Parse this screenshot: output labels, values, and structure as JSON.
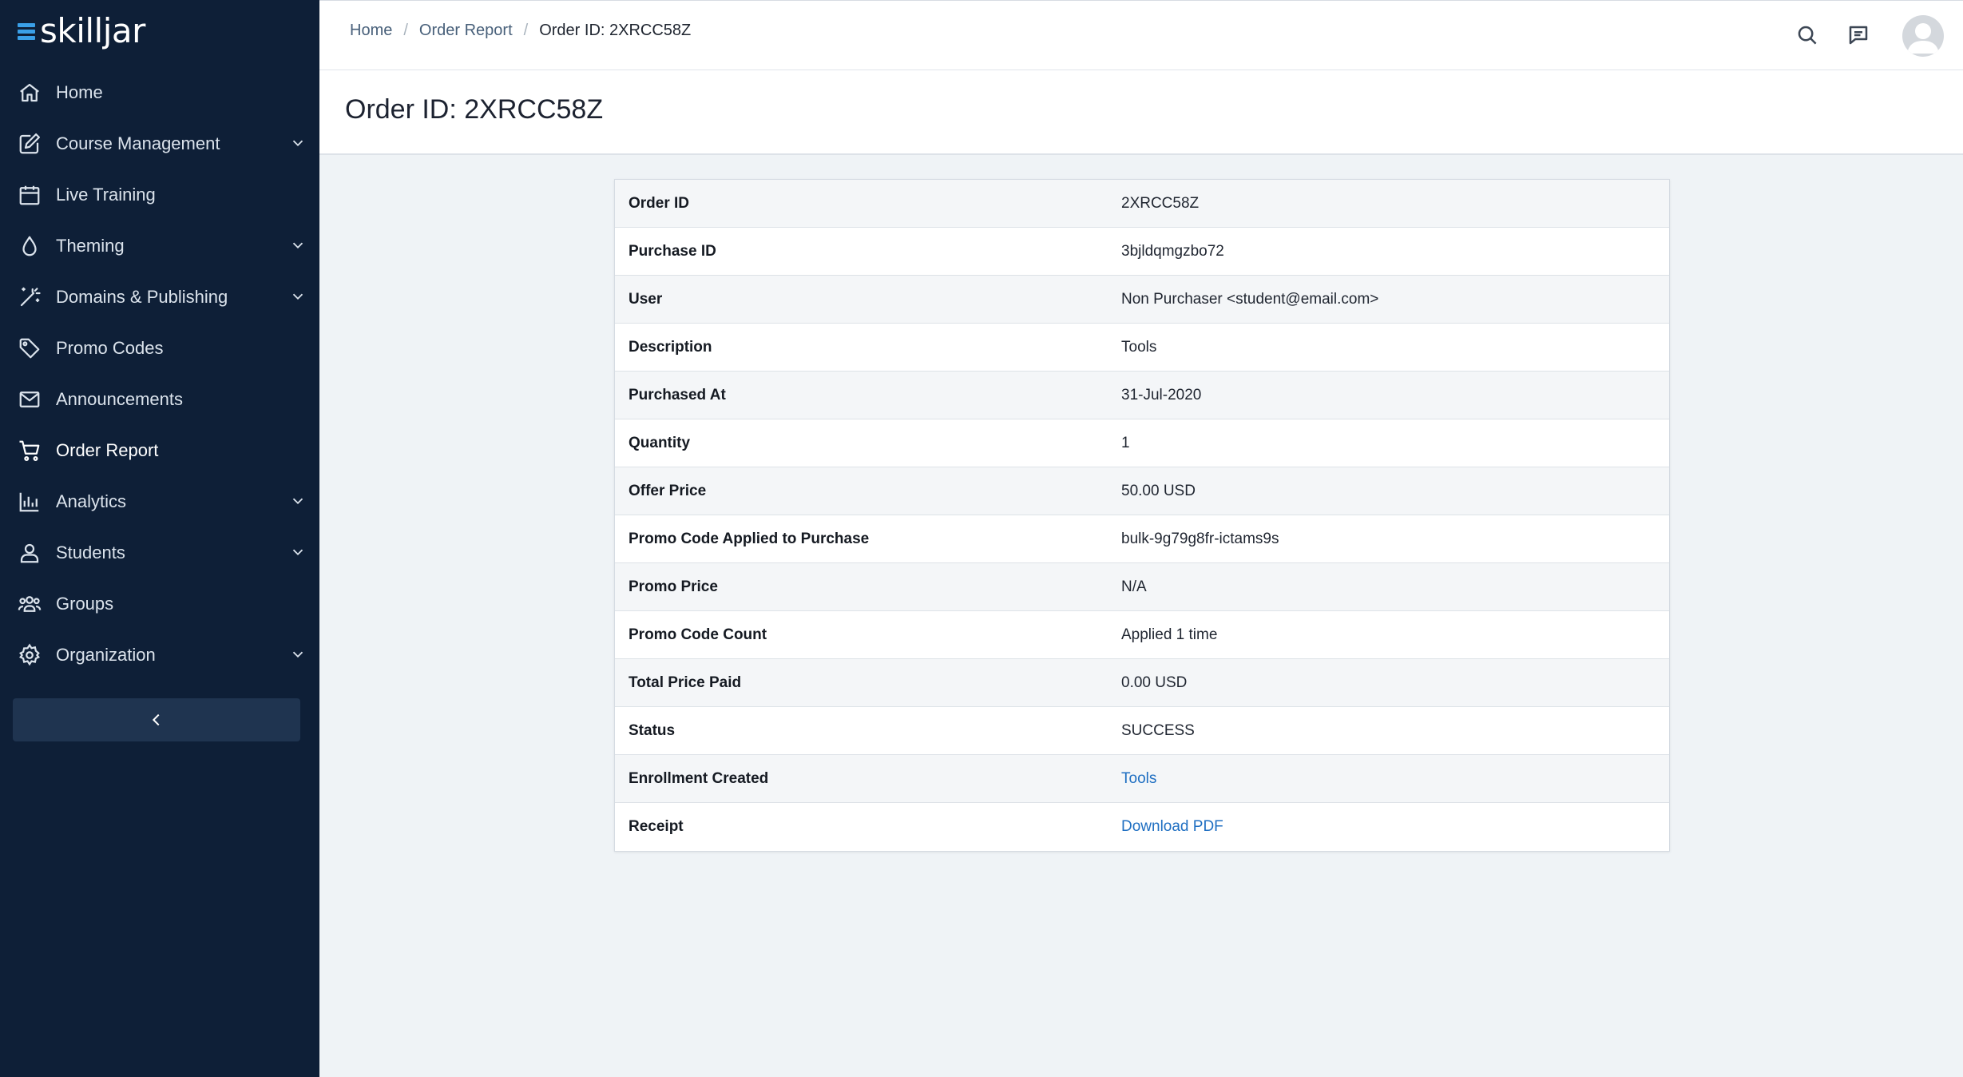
{
  "brand": {
    "logo_text": "skilljar",
    "accent": "#3aa0e8"
  },
  "sidebar": {
    "items": [
      {
        "label": "Home",
        "icon": "home-icon",
        "expandable": false,
        "active": false
      },
      {
        "label": "Course Management",
        "icon": "edit-icon",
        "expandable": true,
        "active": false
      },
      {
        "label": "Live Training",
        "icon": "calendar-icon",
        "expandable": false,
        "active": false
      },
      {
        "label": "Theming",
        "icon": "droplet-icon",
        "expandable": true,
        "active": false
      },
      {
        "label": "Domains & Publishing",
        "icon": "magic-wand-icon",
        "expandable": true,
        "active": false
      },
      {
        "label": "Promo Codes",
        "icon": "tag-icon",
        "expandable": false,
        "active": false
      },
      {
        "label": "Announcements",
        "icon": "mail-icon",
        "expandable": false,
        "active": false
      },
      {
        "label": "Order Report",
        "icon": "cart-icon",
        "expandable": false,
        "active": true
      },
      {
        "label": "Analytics",
        "icon": "bar-chart-icon",
        "expandable": true,
        "active": false
      },
      {
        "label": "Students",
        "icon": "user-icon",
        "expandable": true,
        "active": false
      },
      {
        "label": "Groups",
        "icon": "users-icon",
        "expandable": false,
        "active": false
      },
      {
        "label": "Organization",
        "icon": "gear-icon",
        "expandable": true,
        "active": false
      }
    ],
    "collapse_icon": "chevron-left-icon"
  },
  "topbar": {
    "breadcrumb": {
      "home": "Home",
      "order_report": "Order Report",
      "current": "Order ID: 2XRCC58Z",
      "separator": "/"
    },
    "icons": [
      "search-icon",
      "comment-icon",
      "avatar"
    ]
  },
  "page": {
    "title": "Order ID: 2XRCC58Z"
  },
  "details": {
    "rows": [
      {
        "label": "Order ID",
        "value": "2XRCC58Z"
      },
      {
        "label": "Purchase ID",
        "value": "3bjldqmgzbo72"
      },
      {
        "label": "User",
        "value": "Non Purchaser <student@email.com>"
      },
      {
        "label": "Description",
        "value": "Tools"
      },
      {
        "label": "Purchased At",
        "value": "31-Jul-2020"
      },
      {
        "label": "Quantity",
        "value": "1"
      },
      {
        "label": "Offer Price",
        "value": "50.00 USD"
      },
      {
        "label": "Promo Code Applied to Purchase",
        "value": "bulk-9g79g8fr-ictams9s"
      },
      {
        "label": "Promo Price",
        "value": "N/A"
      },
      {
        "label": "Promo Code Count",
        "value": "Applied 1 time"
      },
      {
        "label": "Total Price Paid",
        "value": "0.00 USD"
      },
      {
        "label": "Status",
        "value": "SUCCESS"
      },
      {
        "label": "Enrollment Created",
        "value": "Tools",
        "link": true
      },
      {
        "label": "Receipt",
        "value": "Download PDF",
        "link": true
      }
    ]
  }
}
